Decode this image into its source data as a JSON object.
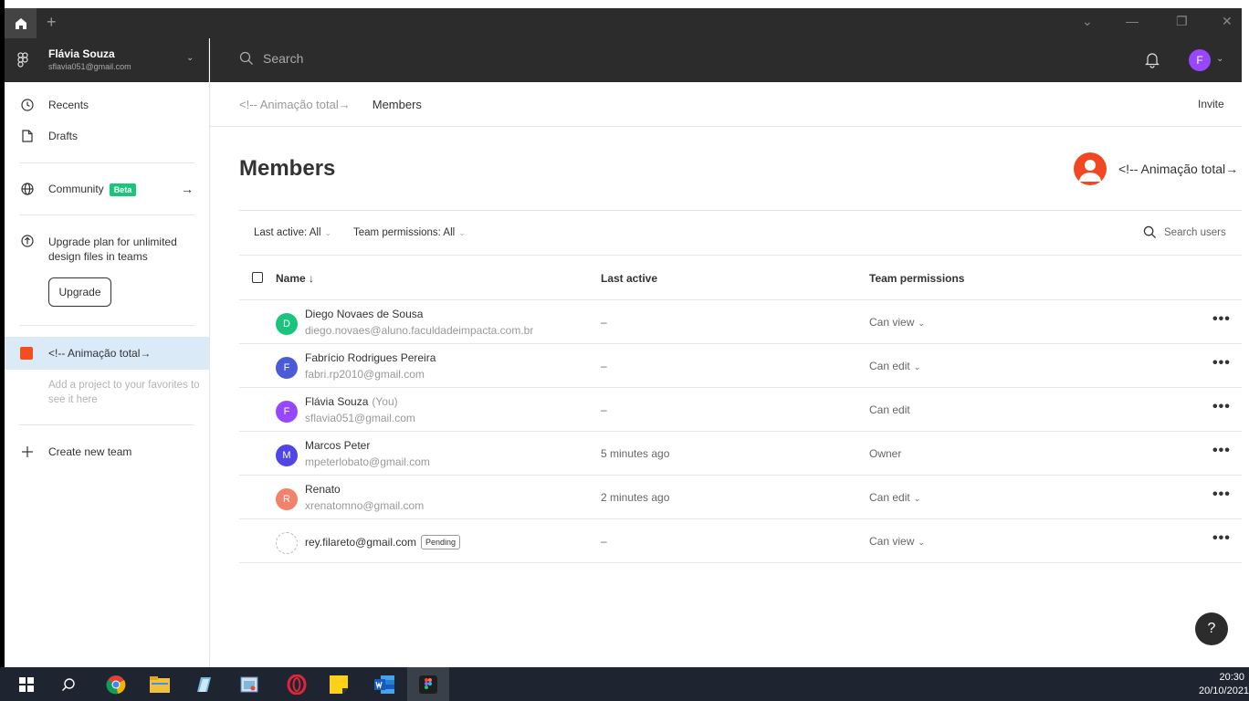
{
  "window": {
    "new_tab": "+",
    "minimize": "—",
    "restore": "❐",
    "close": "✕",
    "dropdown": "⌄"
  },
  "user": {
    "name": "Flávia Souza",
    "email": "sflavia051@gmail.com",
    "avatar_letter": "F"
  },
  "search": {
    "placeholder": "Search"
  },
  "sidebar": {
    "recents": "Recents",
    "drafts": "Drafts",
    "community": "Community",
    "beta": "Beta",
    "upgrade_text": "Upgrade plan for unlimited design files in teams",
    "upgrade_button": "Upgrade",
    "team": "<!-- Animação total→",
    "favorites_note": "Add a project to your favorites to see it here",
    "create_team": "Create new team"
  },
  "breadcrumb": {
    "parent": "<!-- Animação total→",
    "current": "Members"
  },
  "invite": "Invite",
  "page": {
    "title": "Members",
    "team_name": "<!-- Animação total→"
  },
  "filters": {
    "last_active": "Last active: All",
    "permissions": "Team permissions: All",
    "search_users": "Search users"
  },
  "table": {
    "headers": {
      "name": "Name ↓",
      "last_active": "Last active",
      "permissions": "Team permissions"
    },
    "rows": [
      {
        "letter": "D",
        "color": "#1bc47d",
        "name": "Diego Novaes de Sousa",
        "email": "diego.novaes@aluno.faculdadeimpacta.com.br",
        "last_active": "–",
        "permission": "Can view",
        "has_dropdown": true
      },
      {
        "letter": "F",
        "color": "#4b5bd6",
        "name": "Fabrício Rodrigues Pereira",
        "email": "fabri.rp2010@gmail.com",
        "last_active": "–",
        "permission": "Can edit",
        "has_dropdown": true
      },
      {
        "letter": "F",
        "color": "#9747ff",
        "name": "Flávia Souza",
        "you": "(You)",
        "email": "sflavia051@gmail.com",
        "last_active": "–",
        "permission": "Can edit",
        "has_dropdown": false
      },
      {
        "letter": "M",
        "color": "#4f46e5",
        "name": "Marcos Peter",
        "email": "mpeterlobato@gmail.com",
        "last_active": "5 minutes ago",
        "permission": "Owner",
        "has_dropdown": false
      },
      {
        "letter": "R",
        "color": "#f2836b",
        "name": "Renato",
        "email": "xrenatomno@gmail.com",
        "last_active": "2 minutes ago",
        "permission": "Can edit",
        "has_dropdown": true
      },
      {
        "pending": true,
        "email": "rey.filareto@gmail.com",
        "pending_label": "Pending",
        "last_active": "–",
        "permission": "Can view",
        "has_dropdown": true
      }
    ],
    "more": "•••"
  },
  "help": "?",
  "taskbar": {
    "time": "20:30",
    "date": "20/10/2021"
  }
}
